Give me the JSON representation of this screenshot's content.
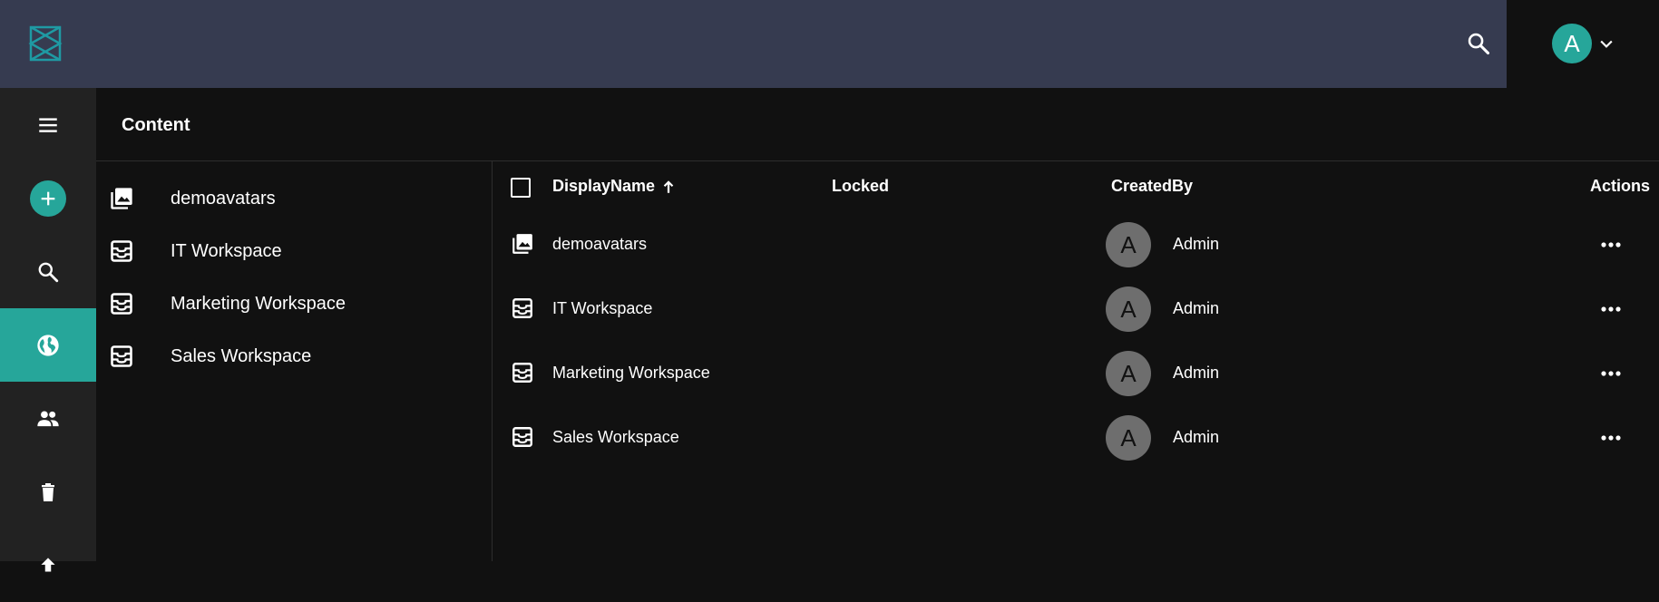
{
  "app": {
    "logo_icon": "logo-icon",
    "accent_color": "#26a69a",
    "topbar_color": "#363b50"
  },
  "header": {
    "search_icon": "search-icon",
    "user_initial": "A",
    "chevron_icon": "chevron-down-icon"
  },
  "nav": {
    "items": [
      {
        "icon": "menu-icon"
      },
      {
        "icon": "add-icon"
      },
      {
        "icon": "search-icon"
      },
      {
        "icon": "globe-icon",
        "active": true
      },
      {
        "icon": "users-icon"
      },
      {
        "icon": "trash-icon"
      }
    ]
  },
  "page": {
    "title": "Content"
  },
  "tree": {
    "items": [
      {
        "label": "demoavatars",
        "icon": "image-library-icon"
      },
      {
        "label": "IT Workspace",
        "icon": "workspace-icon"
      },
      {
        "label": "Marketing Workspace",
        "icon": "workspace-icon"
      },
      {
        "label": "Sales Workspace",
        "icon": "workspace-icon"
      }
    ]
  },
  "grid": {
    "columns": {
      "display_name": "DisplayName",
      "locked": "Locked",
      "created_by": "CreatedBy",
      "actions": "Actions"
    },
    "rows": [
      {
        "name": "demoavatars",
        "icon": "image-library-icon",
        "creator_initial": "A",
        "created_by": "Admin"
      },
      {
        "name": "IT Workspace",
        "icon": "workspace-icon",
        "creator_initial": "A",
        "created_by": "Admin"
      },
      {
        "name": "Marketing Workspace",
        "icon": "workspace-icon",
        "creator_initial": "A",
        "created_by": "Admin"
      },
      {
        "name": "Sales Workspace",
        "icon": "workspace-icon",
        "creator_initial": "A",
        "created_by": "Admin"
      }
    ]
  }
}
